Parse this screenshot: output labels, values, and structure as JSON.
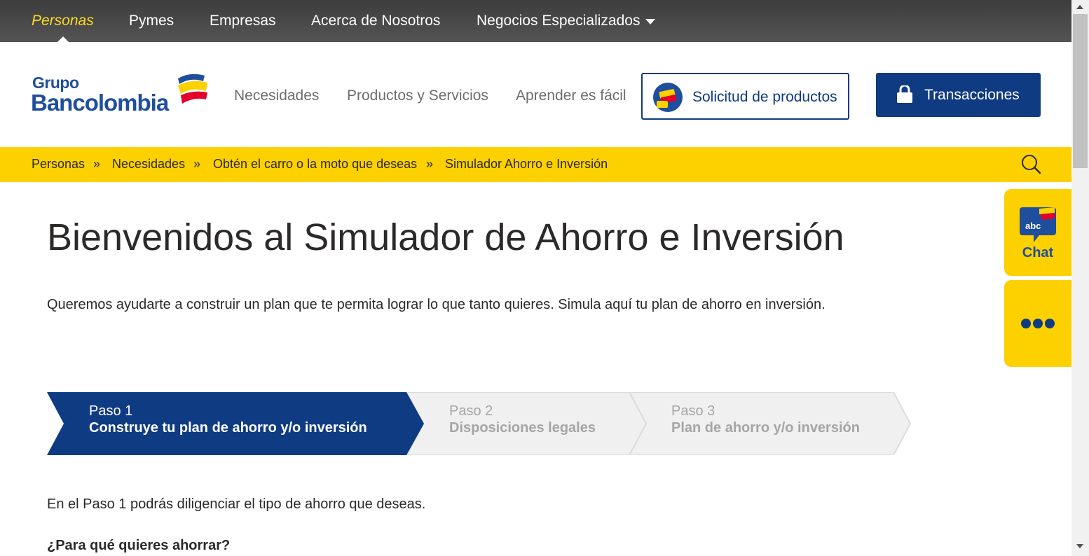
{
  "topnav": {
    "items": [
      {
        "label": "Personas",
        "active": true
      },
      {
        "label": "Pymes",
        "active": false
      },
      {
        "label": "Empresas",
        "active": false
      },
      {
        "label": "Acerca de Nosotros",
        "active": false
      },
      {
        "label": "Negocios Especializados",
        "active": false
      }
    ]
  },
  "header": {
    "logo": {
      "line1": "Grupo",
      "line2": "Bancolombia"
    },
    "nav": [
      "Necesidades",
      "Productos y Servicios",
      "Aprender es fácil"
    ],
    "solicitud_label": "Solicitud de productos",
    "transacciones_label": "Transacciones"
  },
  "breadcrumb": {
    "items": [
      "Personas",
      "Necesidades",
      "Obtén el carro o la moto que deseas",
      "Simulador Ahorro e Inversión"
    ],
    "separator": "»"
  },
  "main": {
    "title": "Bienvenidos al Simulador de Ahorro e Inversión",
    "intro": "Queremos ayudarte a construir un plan que te permita lograr lo que tanto quieres. Simula aquí tu plan de ahorro en inversión.",
    "steps": [
      {
        "number": "Paso 1",
        "name": "Construye tu plan de ahorro y/o inversión",
        "active": true
      },
      {
        "number": "Paso 2",
        "name": "Disposiciones legales",
        "active": false
      },
      {
        "number": "Paso 3",
        "name": "Plan de ahorro y/o inversión",
        "active": false
      }
    ],
    "step_intro": "En el Paso 1 podrás diligenciar el tipo de ahorro que deseas.",
    "question": "¿Para qué quieres ahorrar?"
  },
  "side": {
    "chat_label": "Chat",
    "chat_icon_text": "abc"
  },
  "colors": {
    "brand_blue": "#0f3b82",
    "brand_yellow": "#fdd000",
    "brand_red": "#e4002b",
    "topbar_bg": "#474747",
    "step_inactive_bg": "#f0f0f0"
  }
}
